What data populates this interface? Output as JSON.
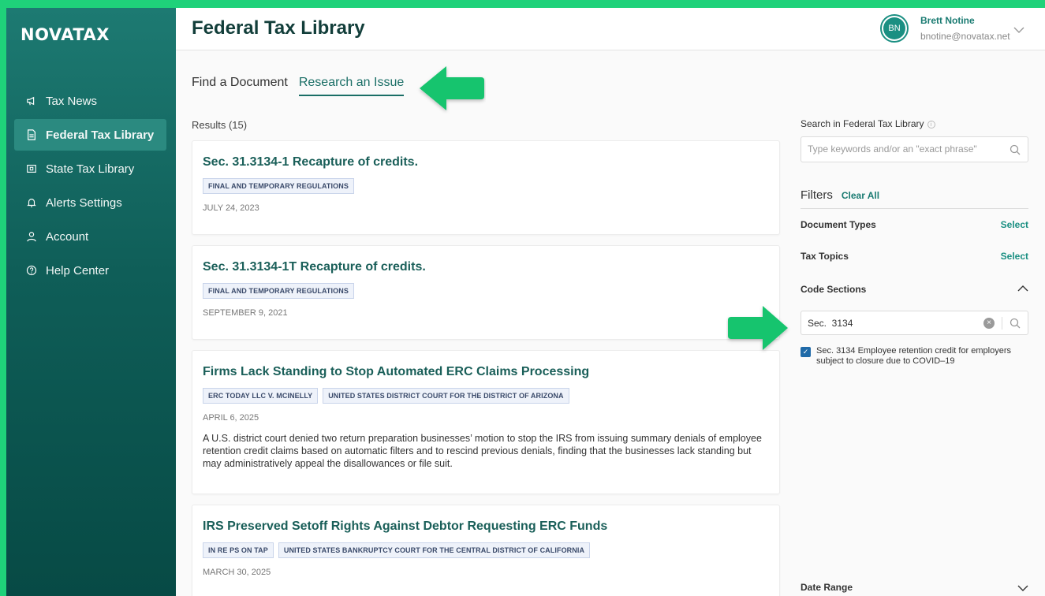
{
  "brand": {
    "logo": "NOVATAX"
  },
  "sidebar": {
    "items": [
      {
        "label": "Tax News",
        "icon": "megaphone-icon",
        "active": false
      },
      {
        "label": "Federal Tax Library",
        "icon": "document-icon",
        "active": true
      },
      {
        "label": "State Tax Library",
        "icon": "library-icon",
        "active": false
      },
      {
        "label": "Alerts Settings",
        "icon": "bell-icon",
        "active": false
      },
      {
        "label": "Account",
        "icon": "person-icon",
        "active": false
      },
      {
        "label": "Help Center",
        "icon": "help-icon",
        "active": false
      }
    ]
  },
  "header": {
    "title": "Federal Tax Library"
  },
  "user": {
    "initials": "BN",
    "name": "Brett Notine",
    "email": "bnotine@novatax.net"
  },
  "tabs": [
    {
      "label": "Find a Document",
      "active": false
    },
    {
      "label": "Research an Issue",
      "active": true
    }
  ],
  "results": {
    "count_label": "Results (15)",
    "items": [
      {
        "title": "Sec. 31.3134-1 Recapture of credits.",
        "tags": [
          "FINAL AND TEMPORARY REGULATIONS"
        ],
        "date": "JULY 24, 2023",
        "summary": ""
      },
      {
        "title": "Sec. 31.3134-1T Recapture of credits.",
        "tags": [
          "FINAL AND TEMPORARY REGULATIONS"
        ],
        "date": "SEPTEMBER 9, 2021",
        "summary": ""
      },
      {
        "title": "Firms Lack Standing to Stop Automated ERC Claims Processing",
        "tags": [
          "ERC TODAY LLC V. MCINELLY",
          "UNITED STATES DISTRICT COURT FOR THE DISTRICT OF ARIZONA"
        ],
        "date": "APRIL 6, 2025",
        "summary": "A U.S. district court denied two return preparation businesses’ motion to stop the IRS from issuing summary denials of employee retention credit claims based on automatic filters and to rescind previous denials, finding that the businesses lack standing but may administratively appeal the disallowances or file suit."
      },
      {
        "title": "IRS Preserved Setoff Rights Against Debtor Requesting ERC Funds",
        "tags": [
          "IN RE PS ON TAP",
          "UNITED STATES BANKRUPTCY COURT FOR THE CENTRAL DISTRICT OF CALIFORNIA"
        ],
        "date": "MARCH 30, 2025",
        "summary": ""
      }
    ]
  },
  "search": {
    "label": "Search in Federal Tax Library",
    "placeholder": "Type keywords and/or an \"exact phrase\""
  },
  "filters": {
    "title": "Filters",
    "clear_all": "Clear All",
    "document_types": {
      "label": "Document Types",
      "action": "Select"
    },
    "tax_topics": {
      "label": "Tax Topics",
      "action": "Select"
    },
    "code_sections": {
      "label": "Code Sections",
      "input_value": "Sec.  3134",
      "checked_option": "Sec. 3134 Employee retention credit for employers subject to closure due to COVID–19",
      "checked": true
    },
    "date_range": {
      "label": "Date Range"
    }
  },
  "colors": {
    "border_green": "#1fd27a",
    "sidebar_top": "#1d7a72",
    "sidebar_bottom": "#074a45",
    "accent_teal": "#1a7b72",
    "arrow_green": "#16c46e"
  }
}
